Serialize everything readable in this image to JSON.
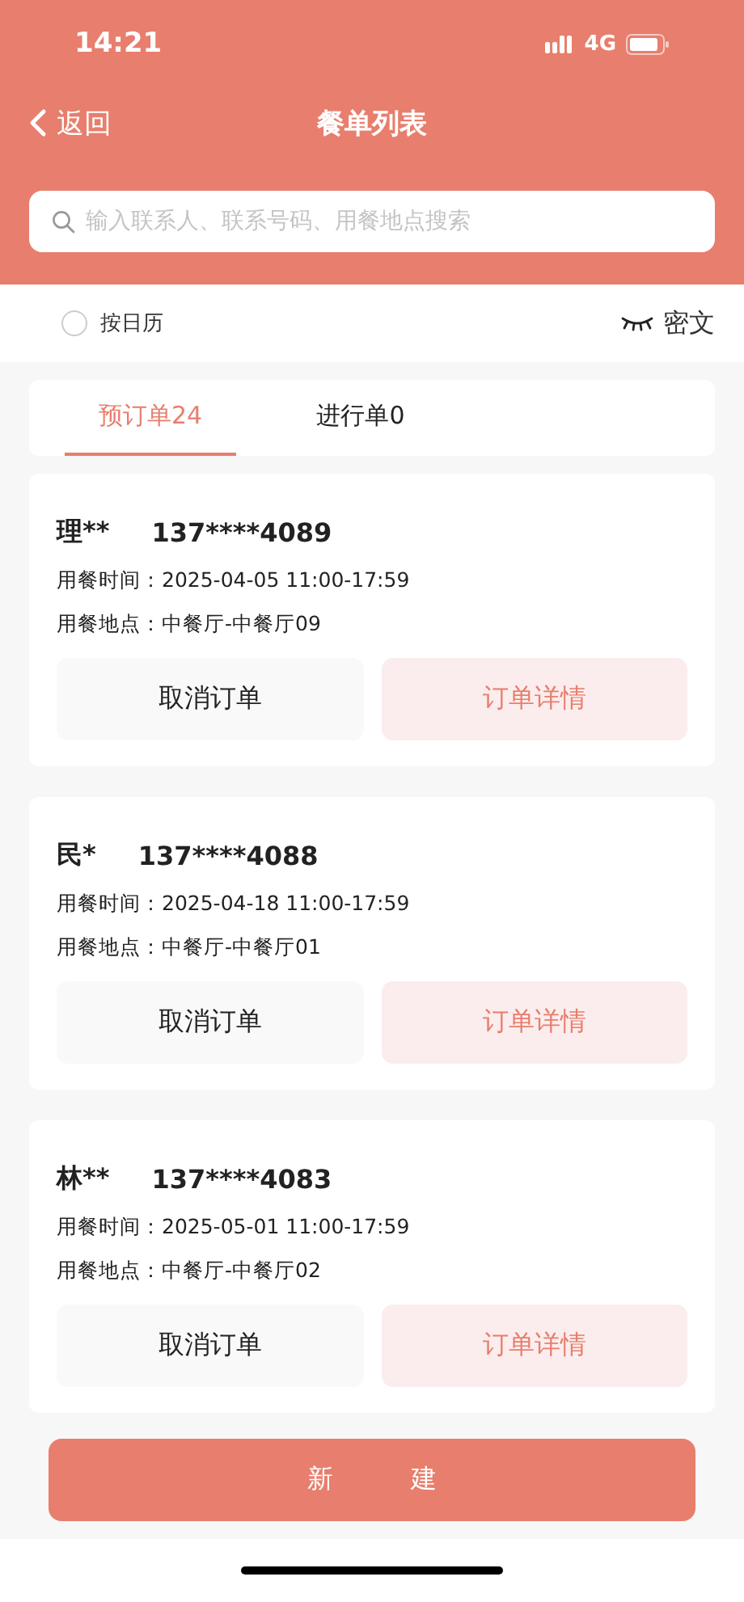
{
  "status_bar": {
    "time": "14:21",
    "network": "4G"
  },
  "nav": {
    "back": "返回",
    "title": "餐单列表"
  },
  "search": {
    "placeholder": "输入联系人、联系号码、用餐地点搜索"
  },
  "filter": {
    "label": "按日历",
    "checked": false
  },
  "mask_toggle": {
    "label": "密文"
  },
  "tabs": [
    {
      "label": "预订单24",
      "selected": true
    },
    {
      "label": "进行单0",
      "selected": false
    }
  ],
  "orders": [
    {
      "name": "理**",
      "phone": "137****4089",
      "time_label": "用餐时间：",
      "time": "2025-04-05 11:00-17:59",
      "place_label": "用餐地点：",
      "place": "中餐厅-中餐厅09",
      "cancel": "取消订单",
      "detail": "订单详情"
    },
    {
      "name": "民*",
      "phone": "137****4088",
      "time_label": "用餐时间：",
      "time": "2025-04-18 11:00-17:59",
      "place_label": "用餐地点：",
      "place": "中餐厅-中餐厅01",
      "cancel": "取消订单",
      "detail": "订单详情"
    },
    {
      "name": "林**",
      "phone": "137****4083",
      "time_label": "用餐时间：",
      "time": "2025-05-01 11:00-17:59",
      "place_label": "用餐地点：",
      "place": "中餐厅-中餐厅02",
      "cancel": "取消订单",
      "detail": "订单详情"
    }
  ],
  "create_button": "新　　　建"
}
